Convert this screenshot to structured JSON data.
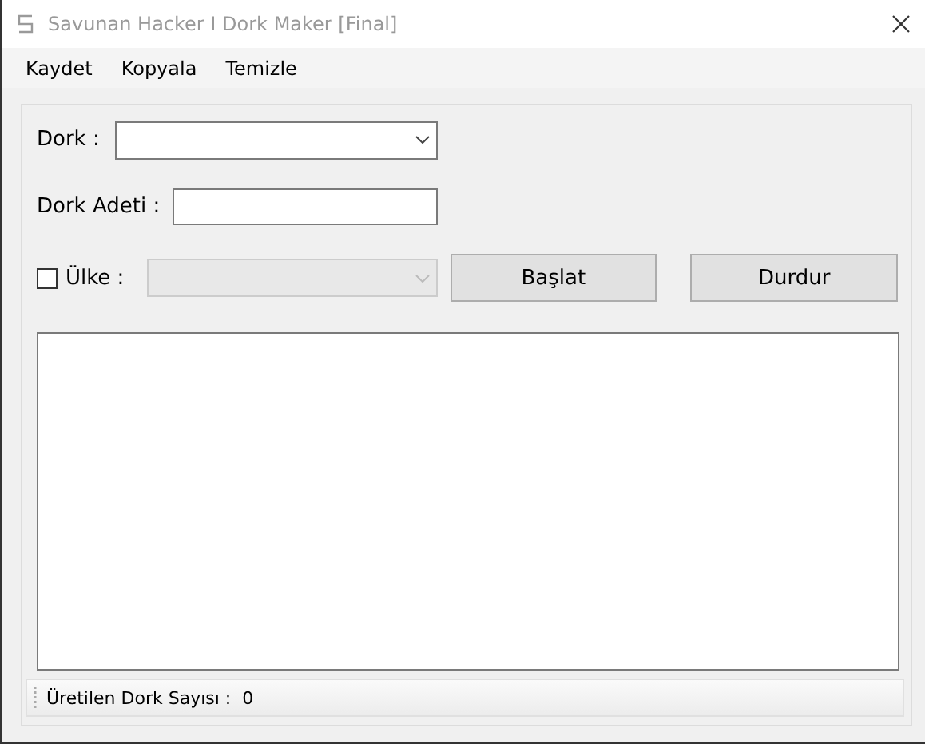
{
  "window": {
    "title": "Savunan Hacker I Dork Maker [Final]"
  },
  "menu": [
    "Kaydet",
    "Kopyala",
    "Temizle"
  ],
  "dork": {
    "label": "Dork :"
  },
  "count": {
    "label": "Dork Adeti :"
  },
  "country": {
    "label": "Ülke :",
    "checked": false,
    "disabled": true
  },
  "buttons": [
    "Başlat",
    "Durdur"
  ],
  "status": {
    "label": "Üretilen Dork Sayısı :",
    "value": "0"
  }
}
